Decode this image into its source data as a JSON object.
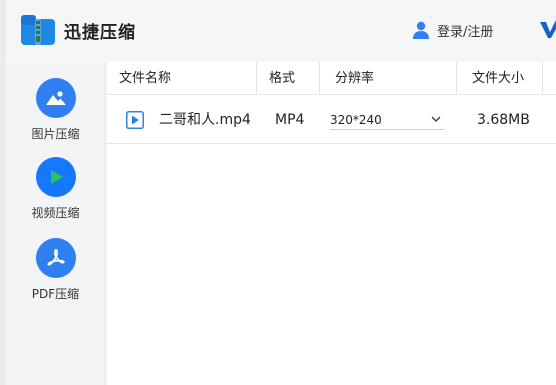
{
  "app": {
    "title": "迅捷压缩"
  },
  "header": {
    "login_label": "登录/注册"
  },
  "sidebar": {
    "items": [
      {
        "label": "图片压缩",
        "icon": "image-icon"
      },
      {
        "label": "视频压缩",
        "icon": "play-icon"
      },
      {
        "label": "PDF压缩",
        "icon": "pdf-icon"
      }
    ],
    "active_index": 1
  },
  "table": {
    "columns": [
      "文件名称",
      "格式",
      "分辨率",
      "文件大小"
    ],
    "rows": [
      {
        "name": "二哥和人.mp4",
        "format": "MP4",
        "resolution": "320*240",
        "size": "3.68MB"
      }
    ]
  },
  "colors": {
    "accent": "#2f7ff0",
    "active": "#1677ff",
    "play_green": "#22c55e"
  }
}
